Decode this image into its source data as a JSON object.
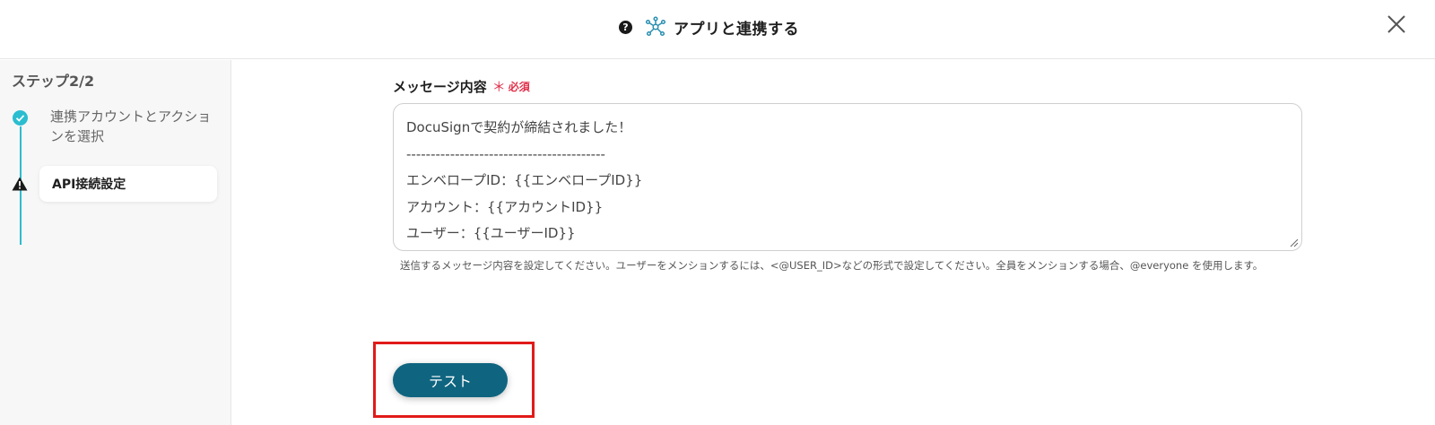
{
  "header": {
    "help_glyph": "?",
    "title": "アプリと連携する",
    "icons": {
      "help": "question-circle-icon",
      "app_link": "network-hub-icon",
      "close": "close-icon"
    },
    "colors": {
      "app_link_icon": "#2a8fb0"
    }
  },
  "sidebar": {
    "step_title": "ステップ2/2",
    "steps": [
      {
        "label": "連携アカウントとアクションを選択",
        "status": "completed",
        "icon": "check-circle-icon"
      },
      {
        "label": "API接続設定",
        "status": "warning",
        "icon": "warning-triangle-icon",
        "active": true
      }
    ],
    "colors": {
      "progress_line": "#2bbdd0",
      "check": "#2bbdd0"
    }
  },
  "form": {
    "field_label": "メッセージ内容",
    "required_mark": "＊",
    "required_text": "必須",
    "message_lines": [
      "DocuSignで契約が締結されました！",
      "-----------------------------------------",
      "エンベロープID：{{エンベロープID}}",
      "アカウント：{{アカウントID}}",
      "ユーザー：{{ユーザーID}}"
    ],
    "help_text": "送信するメッセージ内容を設定してください。ユーザーをメンションするには、<@USER_ID>などの形式で設定してください。全員をメンションする場合、@everyone を使用します。"
  },
  "actions": {
    "test_button_label": "テスト",
    "colors": {
      "test_button": "#0f6580",
      "highlight_border": "#e11a1a",
      "required": "#e0304a"
    }
  }
}
